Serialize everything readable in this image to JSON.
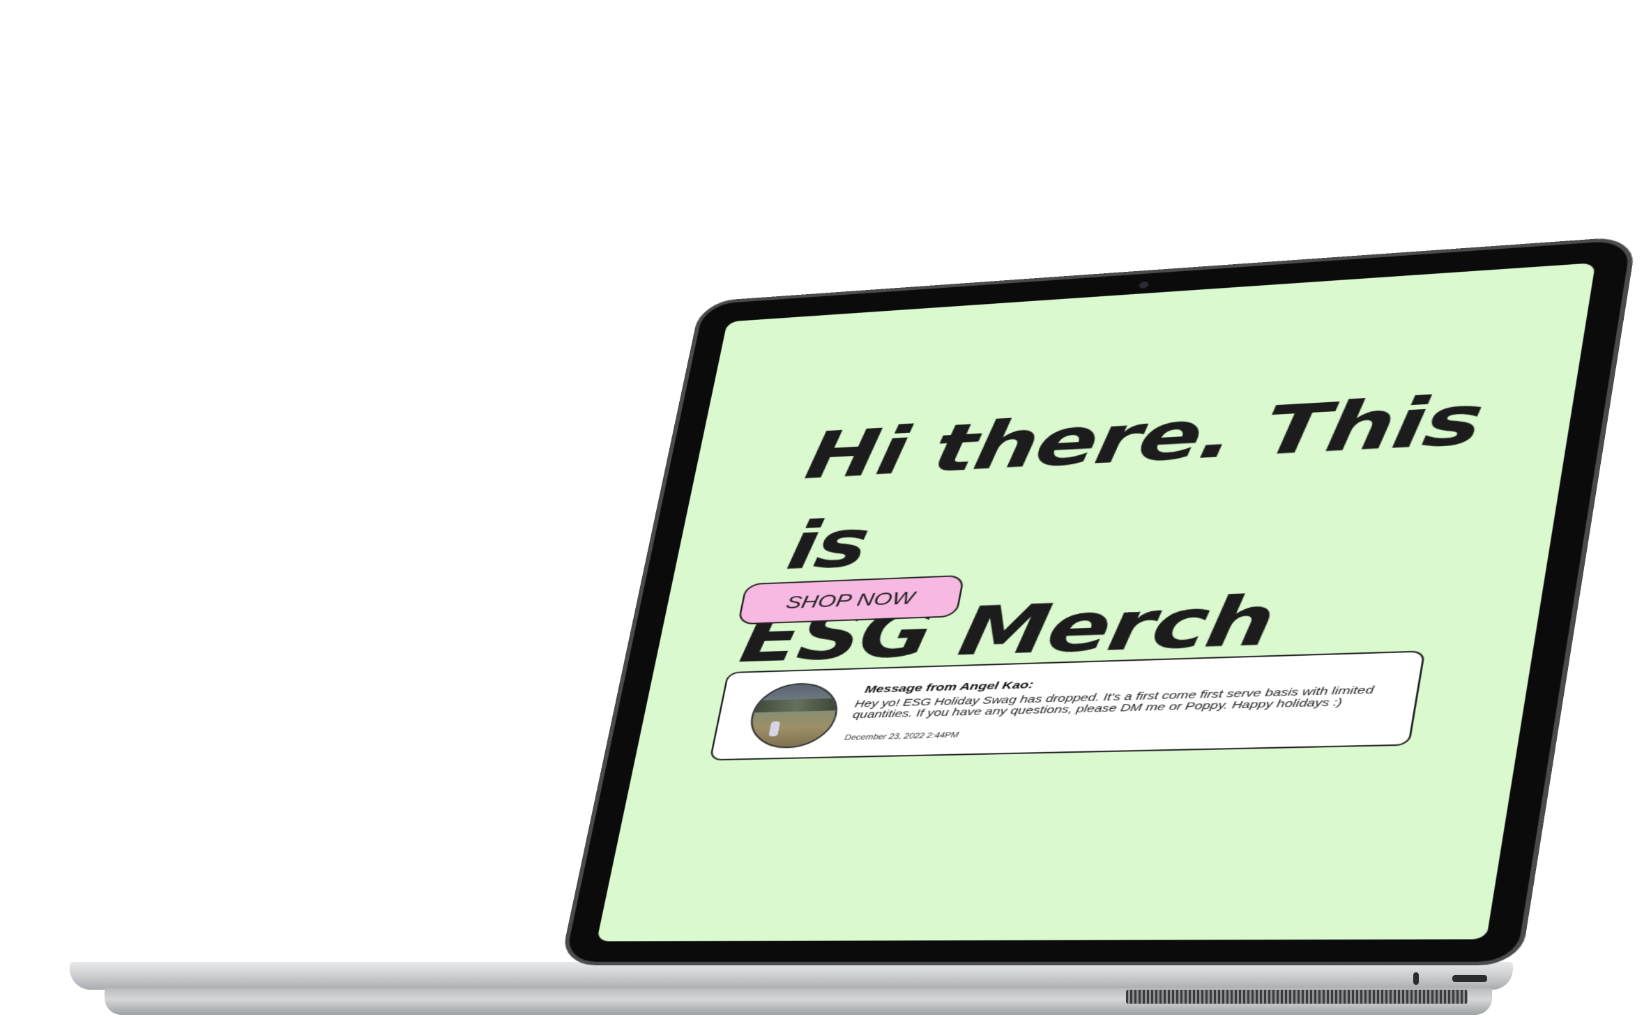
{
  "hero": {
    "line1": "Hi there. This is",
    "line2": "ESG Merch Store."
  },
  "cta": {
    "shop_now_label": "SHOP NOW"
  },
  "message": {
    "title": "Message from Angel Kao:",
    "body": "Hey yo! ESG Holiday Swag has dropped. It's a first come first serve basis with limited quantities. If you have any questions, please DM me or Poppy. Happy holidays :)",
    "timestamp": "December 23, 2022 2:44PM"
  },
  "colors": {
    "screen_background": "#daf9cf",
    "button_background": "#f7b8e2",
    "text": "#1c1c1c"
  },
  "icons": {
    "avatar": "profile-photo"
  }
}
